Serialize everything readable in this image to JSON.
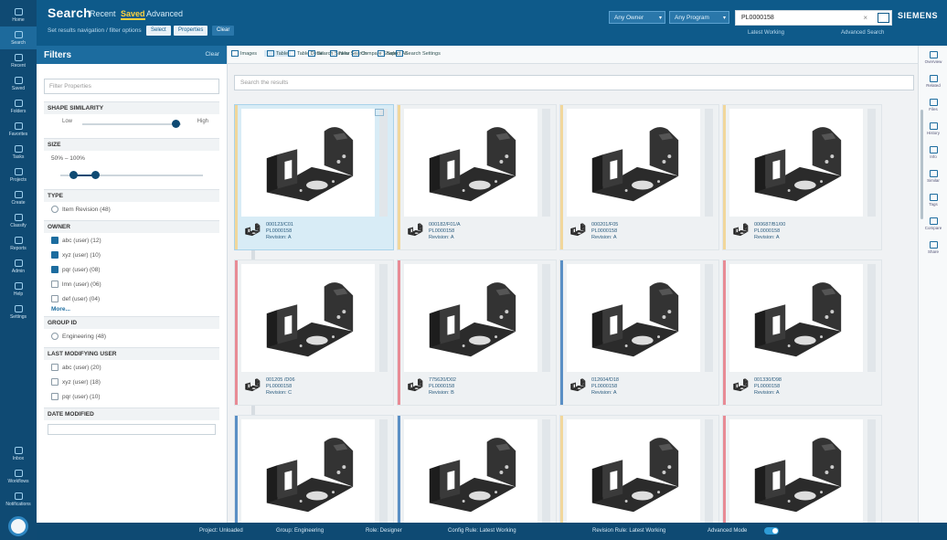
{
  "header": {
    "title": "Search",
    "tabs": [
      "Recent",
      "Saved",
      "Advanced"
    ],
    "active_tab": "Saved",
    "subtitle": "Set results navigation / filter options",
    "pill_1": "Select",
    "pill_2": "Properties",
    "pill_3": "Clear",
    "select_1": "Any Owner",
    "select_2": "Any Program",
    "search_value": "PL0000158",
    "link_latest": "Latest Working",
    "link_advanced": "Advanced Search",
    "logo": "SIEMENS"
  },
  "rail": {
    "items": [
      "Home",
      "Search",
      "Recent",
      "Saved",
      "Folders",
      "Favorites",
      "Tasks",
      "Projects",
      "Create",
      "Classify",
      "Reports",
      "Admin",
      "Help",
      "Settings"
    ],
    "bottom_items": [
      "Inbox",
      "Workflows",
      "Notifications"
    ]
  },
  "filters": {
    "title": "Filters",
    "clear_label": "Clear",
    "input_placeholder": "Filter Properties",
    "shape_header": "SHAPE SIMILARITY",
    "shape_left": "Low",
    "shape_right": "High",
    "size_header": "SIZE",
    "size_range": "50% – 100%",
    "type_header": "TYPE",
    "type_items": [
      {
        "label": "Item Revision (48)",
        "on": false
      }
    ],
    "owner_header": "OWNER",
    "owner_items": [
      {
        "label": "abc (user) (12)",
        "on": true
      },
      {
        "label": "xyz (user) (10)",
        "on": true
      },
      {
        "label": "pqr (user) (08)",
        "on": true
      },
      {
        "label": "lmn (user) (06)",
        "on": false
      },
      {
        "label": "def (user) (04)",
        "on": false
      }
    ],
    "more_label": "More...",
    "group_header": "GROUP ID",
    "group_items": [
      {
        "label": "Engineering (48)",
        "on": false
      }
    ],
    "last_modifying_header": "LAST MODIFYING USER",
    "last_modifying_items": [
      {
        "label": "abc (user) (20)",
        "on": false
      },
      {
        "label": "xyz (user) (18)",
        "on": false
      },
      {
        "label": "pqr (user) (10)",
        "on": false
      }
    ],
    "date_header": "DATE MODIFIED"
  },
  "toolbar": {
    "buttons": [
      "Images",
      "Table",
      "Table Detail",
      "Search Similar",
      "New Search",
      "Compare Shape",
      "Select All",
      "Search Settings"
    ]
  },
  "results_search": {
    "placeholder": "Search the results"
  },
  "cards": [
    {
      "id": "000123/C01",
      "name": "PL0000158",
      "rev": "Revision: A",
      "stripe": "#f1d79b",
      "selected": true
    },
    {
      "id": "000182/F01/A",
      "name": "PL0000158",
      "rev": "Revision: A",
      "stripe": "#f1d79b",
      "selected": false
    },
    {
      "id": "000201/F05",
      "name": "PL0000158",
      "rev": "Revision: A",
      "stripe": "#f1d79b",
      "selected": false
    },
    {
      "id": "000687/B1/00",
      "name": "PL0000158",
      "rev": "Revision: A",
      "stripe": "#f1d79b",
      "selected": false
    },
    {
      "id": "001205 /D06",
      "name": "PL0000158",
      "rev": "Revision: C",
      "stripe": "#e88b95",
      "selected": false
    },
    {
      "id": "775620/D02",
      "name": "PL0000158",
      "rev": "Revision: B",
      "stripe": "#e88b95",
      "selected": false
    },
    {
      "id": "012604/D18",
      "name": "PL0000158",
      "rev": "Revision: A",
      "stripe": "#5a8fc5",
      "selected": false
    },
    {
      "id": "001330/D98",
      "name": "PL0000158",
      "rev": "Revision: A",
      "stripe": "#e88b95",
      "selected": false
    },
    {
      "id": "",
      "name": "",
      "rev": "",
      "stripe": "#5a8fc5",
      "selected": false
    },
    {
      "id": "",
      "name": "",
      "rev": "",
      "stripe": "#5a8fc5",
      "selected": false
    },
    {
      "id": "",
      "name": "",
      "rev": "",
      "stripe": "#f1d79b",
      "selected": false
    },
    {
      "id": "",
      "name": "",
      "rev": "",
      "stripe": "#e88b95",
      "selected": false
    }
  ],
  "right_rail": {
    "items": [
      "Overview",
      "Related",
      "Files",
      "History",
      "Info",
      "Similar",
      "Tags",
      "Compare",
      "Share"
    ]
  },
  "status": {
    "project": "Project: Unloaded",
    "group": "Group: Engineering",
    "role": "Role: Designer",
    "config": "Config Rule: Latest Working",
    "revision": "Revision Rule: Latest Working",
    "advanced": "Advanced Mode",
    "advanced_on": true
  }
}
